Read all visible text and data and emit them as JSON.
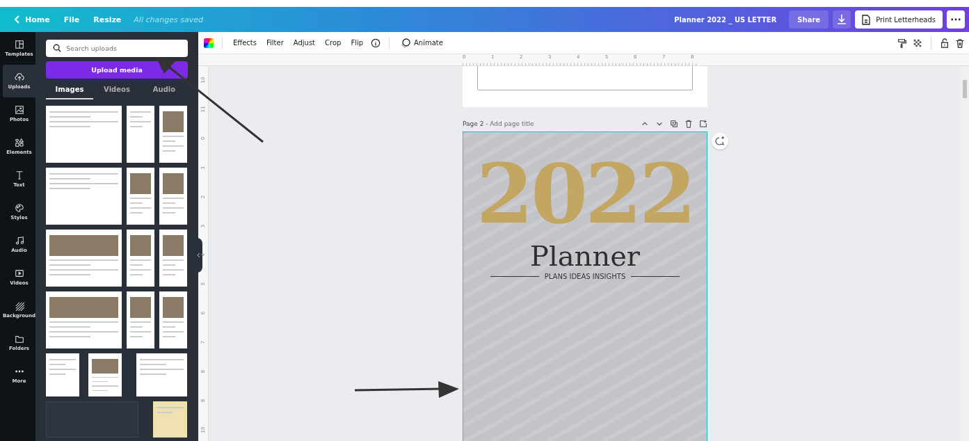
{
  "top_bar": {
    "back": "Home",
    "menu": [
      "File",
      "Resize"
    ],
    "save_status": "All changes saved",
    "document_title": "Planner 2022 _ US LETTER",
    "share": "Share",
    "print": "Print Letterheads"
  },
  "rail": [
    {
      "label": "Templates",
      "kind": "templates",
      "selected": false
    },
    {
      "label": "Uploads",
      "kind": "uploads",
      "selected": true
    },
    {
      "label": "Photos",
      "kind": "photos",
      "selected": false
    },
    {
      "label": "Elements",
      "kind": "elements",
      "selected": false
    },
    {
      "label": "Text",
      "kind": "text",
      "selected": false
    },
    {
      "label": "Styles",
      "kind": "styles",
      "selected": false
    },
    {
      "label": "Audio",
      "kind": "audio",
      "selected": false
    },
    {
      "label": "Videos",
      "kind": "videos",
      "selected": false
    },
    {
      "label": "Background",
      "kind": "background",
      "selected": false
    },
    {
      "label": "Folders",
      "kind": "folders",
      "selected": false
    },
    {
      "label": "More",
      "kind": "more",
      "selected": false
    }
  ],
  "panel": {
    "search": {
      "placeholder": "Search uploads"
    },
    "upload_button": "Upload media",
    "tabs": [
      {
        "label": "Images",
        "selected": true
      },
      {
        "label": "Videos",
        "selected": false
      },
      {
        "label": "Audio",
        "selected": false
      }
    ]
  },
  "toolbar": {
    "items": [
      "Effects",
      "Filter",
      "Adjust",
      "Crop",
      "Flip"
    ],
    "animate": "Animate"
  },
  "ruler": {
    "horizontal": [
      "0",
      "1",
      "2",
      "3",
      "4",
      "5",
      "6",
      "7",
      "8"
    ],
    "vertical": [
      "10",
      "11",
      "0",
      "1",
      "2",
      "3",
      "4",
      "5",
      "6",
      "7",
      "8",
      "9",
      "10"
    ]
  },
  "page": {
    "number": "Page 2",
    "title_placeholder": " - Add page title",
    "year": "2022",
    "heading": "Planner",
    "tagline": "PLANS IDEAS INSIGHTS"
  }
}
